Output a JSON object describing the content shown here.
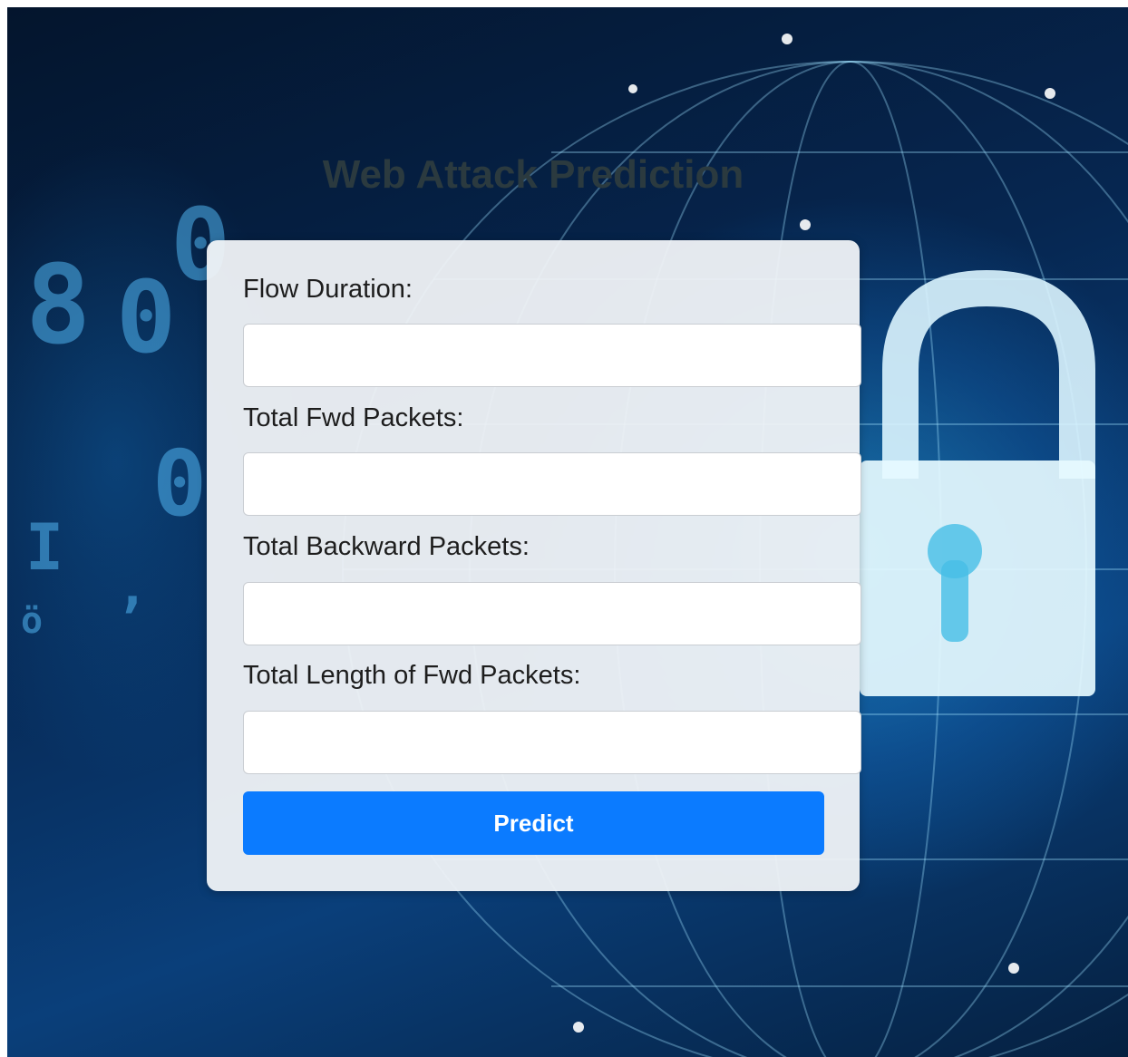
{
  "header": {
    "title": "Web Attack Prediction"
  },
  "form": {
    "fields": [
      {
        "label": "Flow Duration:",
        "value": "",
        "placeholder": ""
      },
      {
        "label": "Total Fwd Packets:",
        "value": "",
        "placeholder": ""
      },
      {
        "label": "Total Backward Packets:",
        "value": "",
        "placeholder": ""
      },
      {
        "label": "Total Length of Fwd Packets:",
        "value": "",
        "placeholder": ""
      }
    ],
    "submit_label": "Predict"
  },
  "colors": {
    "accent": "#0b7bff",
    "title_text": "#2b3a3f",
    "card_background": "#f0f3f7"
  }
}
